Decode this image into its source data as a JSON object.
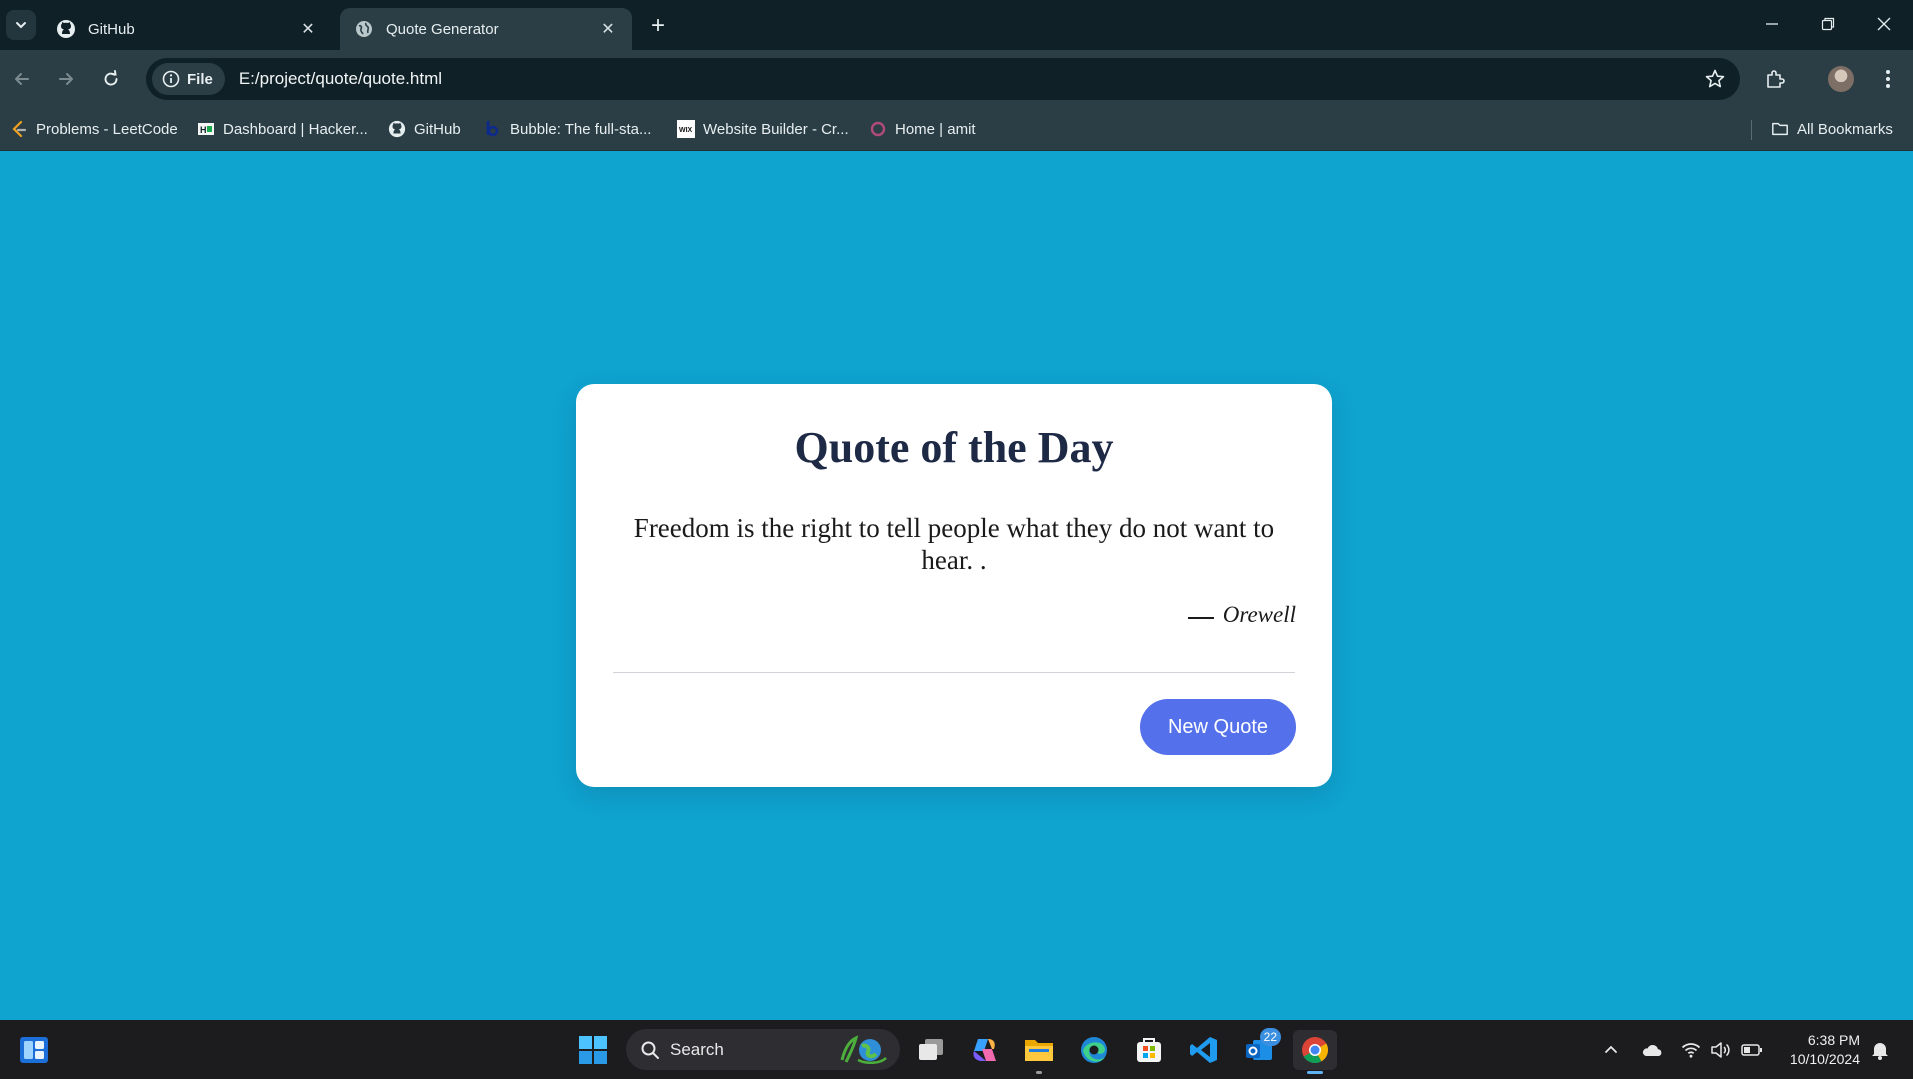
{
  "browser": {
    "tabs": [
      {
        "title": "GitHub",
        "icon": "github-icon",
        "active": false
      },
      {
        "title": "Quote Generator",
        "icon": "globe-icon",
        "active": true
      }
    ],
    "address": {
      "chip_label": "File",
      "url": "E:/project/quote/quote.html"
    },
    "bookmarks": [
      {
        "label": "Problems - LeetCode",
        "icon": "leetcode-icon"
      },
      {
        "label": "Dashboard | Hacker...",
        "icon": "hackerrank-icon"
      },
      {
        "label": "GitHub",
        "icon": "github-icon"
      },
      {
        "label": "Bubble: The full-sta...",
        "icon": "bubble-icon"
      },
      {
        "label": "Website Builder - Cr...",
        "icon": "wix-icon"
      },
      {
        "label": "Home | amit",
        "icon": "circle-icon"
      }
    ],
    "all_bookmarks_label": "All Bookmarks"
  },
  "page": {
    "background_color": "#0fa3d0",
    "card": {
      "title": "Quote of the Day",
      "quote": "Freedom is the right to tell people what they do not want to hear. .",
      "author": "Orewell",
      "button_label": "New Quote",
      "button_color": "#5470ea"
    }
  },
  "taskbar": {
    "search_label": "Search",
    "notification_badge": "22",
    "time": "6:38 PM",
    "date": "10/10/2024"
  }
}
